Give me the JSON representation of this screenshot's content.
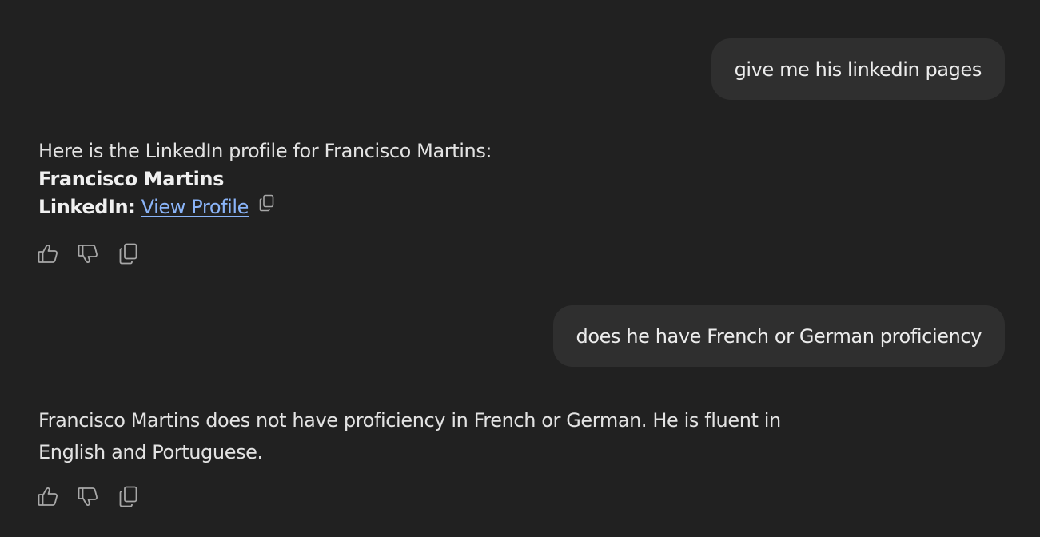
{
  "messages": {
    "user_1": "give me his linkedin pages",
    "assistant_1": {
      "intro": "Here is the LinkedIn profile for Francisco Martins:",
      "name": "Francisco Martins",
      "linkedin_label": "LinkedIn:",
      "link_text": "View Profile"
    },
    "user_2": "does he have French or German proficiency",
    "assistant_2": "Francisco Martins does not have proficiency in French or German. He is fluent in English and Portuguese."
  },
  "actions": {
    "icons": [
      "thumbs-up-icon",
      "thumbs-down-icon",
      "copy-icon"
    ]
  },
  "colors": {
    "background": "#212121",
    "bubble": "#2f2f2f",
    "text": "#ececec",
    "link": "#8ab4f8",
    "icon": "#a8a8a8"
  }
}
